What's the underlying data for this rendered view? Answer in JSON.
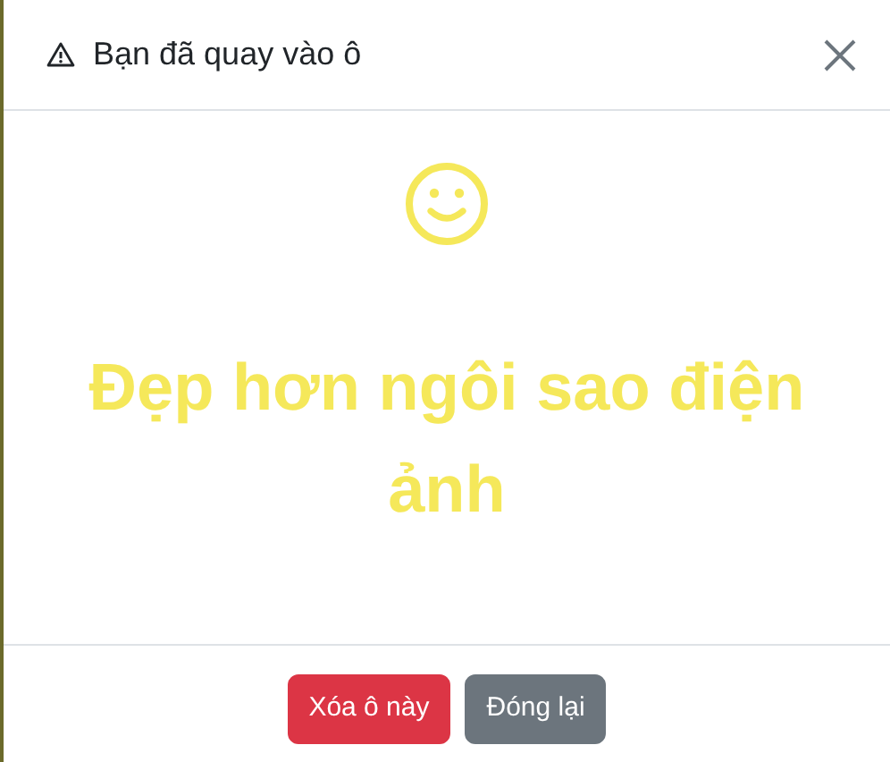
{
  "modal": {
    "title": "Bạn đã quay vào ô",
    "message": "Đẹp hơn ngôi sao điện ảnh",
    "buttons": [
      {
        "label": "Xóa ô này",
        "kind": "danger"
      },
      {
        "label": "Đóng lại",
        "kind": "secondary"
      }
    ]
  }
}
